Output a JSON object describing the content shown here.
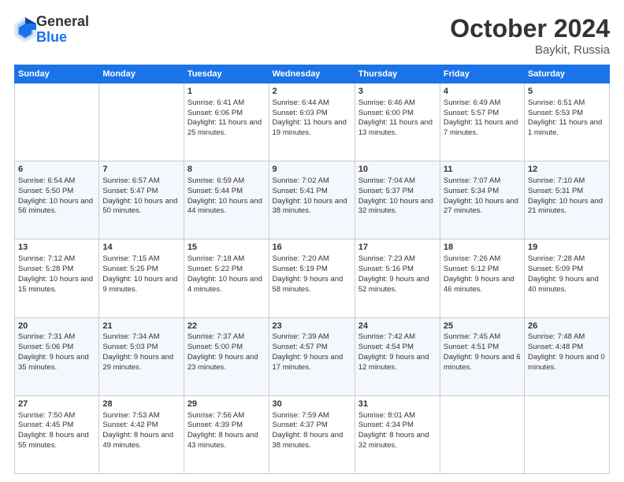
{
  "header": {
    "logo": {
      "general": "General",
      "blue": "Blue"
    },
    "title": "October 2024",
    "location": "Baykit, Russia"
  },
  "days_of_week": [
    "Sunday",
    "Monday",
    "Tuesday",
    "Wednesday",
    "Thursday",
    "Friday",
    "Saturday"
  ],
  "weeks": [
    [
      {
        "day": "",
        "content": ""
      },
      {
        "day": "",
        "content": ""
      },
      {
        "day": "1",
        "content": "Sunrise: 6:41 AM\nSunset: 6:06 PM\nDaylight: 11 hours and 25 minutes."
      },
      {
        "day": "2",
        "content": "Sunrise: 6:44 AM\nSunset: 6:03 PM\nDaylight: 11 hours and 19 minutes."
      },
      {
        "day": "3",
        "content": "Sunrise: 6:46 AM\nSunset: 6:00 PM\nDaylight: 11 hours and 13 minutes."
      },
      {
        "day": "4",
        "content": "Sunrise: 6:49 AM\nSunset: 5:57 PM\nDaylight: 11 hours and 7 minutes."
      },
      {
        "day": "5",
        "content": "Sunrise: 6:51 AM\nSunset: 5:53 PM\nDaylight: 11 hours and 1 minute."
      }
    ],
    [
      {
        "day": "6",
        "content": "Sunrise: 6:54 AM\nSunset: 5:50 PM\nDaylight: 10 hours and 56 minutes."
      },
      {
        "day": "7",
        "content": "Sunrise: 6:57 AM\nSunset: 5:47 PM\nDaylight: 10 hours and 50 minutes."
      },
      {
        "day": "8",
        "content": "Sunrise: 6:59 AM\nSunset: 5:44 PM\nDaylight: 10 hours and 44 minutes."
      },
      {
        "day": "9",
        "content": "Sunrise: 7:02 AM\nSunset: 5:41 PM\nDaylight: 10 hours and 38 minutes."
      },
      {
        "day": "10",
        "content": "Sunrise: 7:04 AM\nSunset: 5:37 PM\nDaylight: 10 hours and 32 minutes."
      },
      {
        "day": "11",
        "content": "Sunrise: 7:07 AM\nSunset: 5:34 PM\nDaylight: 10 hours and 27 minutes."
      },
      {
        "day": "12",
        "content": "Sunrise: 7:10 AM\nSunset: 5:31 PM\nDaylight: 10 hours and 21 minutes."
      }
    ],
    [
      {
        "day": "13",
        "content": "Sunrise: 7:12 AM\nSunset: 5:28 PM\nDaylight: 10 hours and 15 minutes."
      },
      {
        "day": "14",
        "content": "Sunrise: 7:15 AM\nSunset: 5:25 PM\nDaylight: 10 hours and 9 minutes."
      },
      {
        "day": "15",
        "content": "Sunrise: 7:18 AM\nSunset: 5:22 PM\nDaylight: 10 hours and 4 minutes."
      },
      {
        "day": "16",
        "content": "Sunrise: 7:20 AM\nSunset: 5:19 PM\nDaylight: 9 hours and 58 minutes."
      },
      {
        "day": "17",
        "content": "Sunrise: 7:23 AM\nSunset: 5:16 PM\nDaylight: 9 hours and 52 minutes."
      },
      {
        "day": "18",
        "content": "Sunrise: 7:26 AM\nSunset: 5:12 PM\nDaylight: 9 hours and 46 minutes."
      },
      {
        "day": "19",
        "content": "Sunrise: 7:28 AM\nSunset: 5:09 PM\nDaylight: 9 hours and 40 minutes."
      }
    ],
    [
      {
        "day": "20",
        "content": "Sunrise: 7:31 AM\nSunset: 5:06 PM\nDaylight: 9 hours and 35 minutes."
      },
      {
        "day": "21",
        "content": "Sunrise: 7:34 AM\nSunset: 5:03 PM\nDaylight: 9 hours and 29 minutes."
      },
      {
        "day": "22",
        "content": "Sunrise: 7:37 AM\nSunset: 5:00 PM\nDaylight: 9 hours and 23 minutes."
      },
      {
        "day": "23",
        "content": "Sunrise: 7:39 AM\nSunset: 4:57 PM\nDaylight: 9 hours and 17 minutes."
      },
      {
        "day": "24",
        "content": "Sunrise: 7:42 AM\nSunset: 4:54 PM\nDaylight: 9 hours and 12 minutes."
      },
      {
        "day": "25",
        "content": "Sunrise: 7:45 AM\nSunset: 4:51 PM\nDaylight: 9 hours and 6 minutes."
      },
      {
        "day": "26",
        "content": "Sunrise: 7:48 AM\nSunset: 4:48 PM\nDaylight: 9 hours and 0 minutes."
      }
    ],
    [
      {
        "day": "27",
        "content": "Sunrise: 7:50 AM\nSunset: 4:45 PM\nDaylight: 8 hours and 55 minutes."
      },
      {
        "day": "28",
        "content": "Sunrise: 7:53 AM\nSunset: 4:42 PM\nDaylight: 8 hours and 49 minutes."
      },
      {
        "day": "29",
        "content": "Sunrise: 7:56 AM\nSunset: 4:39 PM\nDaylight: 8 hours and 43 minutes."
      },
      {
        "day": "30",
        "content": "Sunrise: 7:59 AM\nSunset: 4:37 PM\nDaylight: 8 hours and 38 minutes."
      },
      {
        "day": "31",
        "content": "Sunrise: 8:01 AM\nSunset: 4:34 PM\nDaylight: 8 hours and 32 minutes."
      },
      {
        "day": "",
        "content": ""
      },
      {
        "day": "",
        "content": ""
      }
    ]
  ]
}
